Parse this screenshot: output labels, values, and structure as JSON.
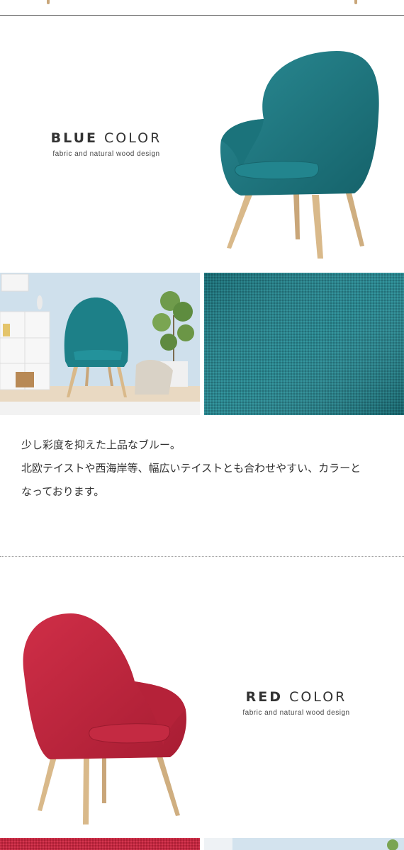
{
  "colors": {
    "blue_fabric": "#1f7d86",
    "red_fabric": "#c2283f",
    "wood": "#d2b48c"
  },
  "blue_section": {
    "title_bold": "BLUE",
    "title_light": "COLOR",
    "subtitle": "fabric and natural wood design",
    "description": [
      "少し彩度を抑えた上品なブルー。",
      "北欧テイストや西海岸等、幅広いテイストとも合わせやすい、カラーと",
      "なっております。"
    ]
  },
  "red_section": {
    "title_bold": "RED",
    "title_light": "COLOR",
    "subtitle": "fabric and natural wood design"
  }
}
